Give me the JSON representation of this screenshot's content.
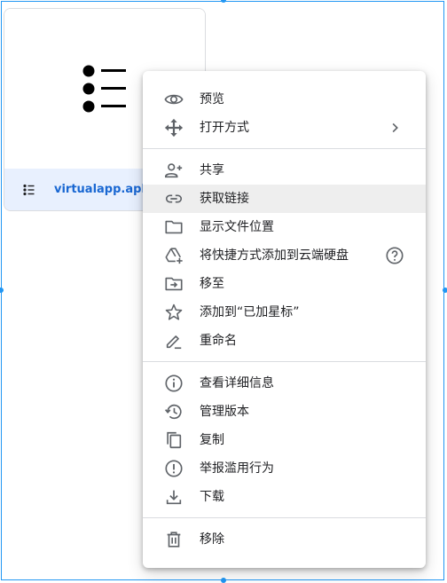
{
  "file": {
    "name": "virtualapp.apk",
    "thumbnail_icon": "list-icon",
    "type_icon": "list-icon"
  },
  "colors": {
    "selection": "#2196f3",
    "file_name": "#1967d2",
    "footer_bg": "#e8f0fe",
    "hover_bg": "#eeeeee",
    "icon": "#5f6368",
    "text": "#202124"
  },
  "menu": {
    "groups": [
      [
        {
          "label": "预览",
          "icon": "eye-icon"
        },
        {
          "label": "打开方式",
          "icon": "move-arrows-icon",
          "submenu": true
        }
      ],
      [
        {
          "label": "共享",
          "icon": "person-add-icon"
        },
        {
          "label": "获取链接",
          "icon": "link-icon",
          "highlighted": true
        },
        {
          "label": "显示文件位置",
          "icon": "folder-icon"
        },
        {
          "label": "将快捷方式添加到云端硬盘",
          "icon": "drive-shortcut-icon",
          "help": true
        },
        {
          "label": "移至",
          "icon": "move-to-folder-icon"
        },
        {
          "label": "添加到“已加星标”",
          "icon": "star-icon"
        },
        {
          "label": "重命名",
          "icon": "pencil-icon"
        }
      ],
      [
        {
          "label": "查看详细信息",
          "icon": "info-icon"
        },
        {
          "label": "管理版本",
          "icon": "history-icon"
        },
        {
          "label": "复制",
          "icon": "copy-icon"
        },
        {
          "label": "举报滥用行为",
          "icon": "report-icon"
        },
        {
          "label": "下载",
          "icon": "download-icon"
        }
      ],
      [
        {
          "label": "移除",
          "icon": "trash-icon"
        }
      ]
    ]
  }
}
